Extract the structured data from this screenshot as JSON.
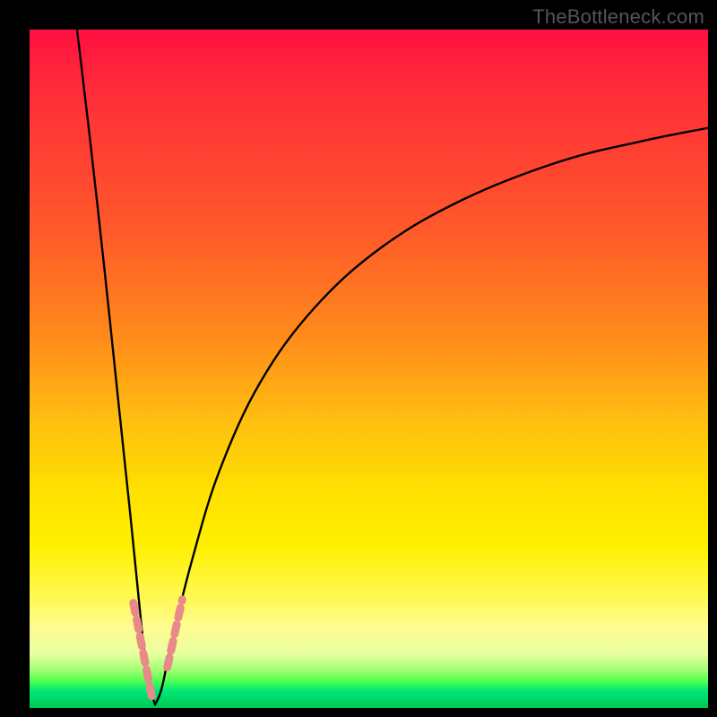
{
  "watermark": "TheBottleneck.com",
  "chart_data": {
    "type": "line",
    "title": "",
    "xlabel": "",
    "ylabel": "",
    "xlim": [
      0,
      100
    ],
    "ylim": [
      0,
      100
    ],
    "grid": false,
    "legend": false,
    "annotations": [],
    "curves": {
      "left_branch": {
        "description": "Steep descending black curve from top-left to valley ~18% width",
        "points": [
          {
            "x": 7.0,
            "y": 100.0
          },
          {
            "x": 9.0,
            "y": 83.0
          },
          {
            "x": 11.0,
            "y": 65.0
          },
          {
            "x": 13.0,
            "y": 46.0
          },
          {
            "x": 15.0,
            "y": 27.0
          },
          {
            "x": 16.5,
            "y": 12.0
          },
          {
            "x": 17.5,
            "y": 4.0
          },
          {
            "x": 18.5,
            "y": 0.5
          }
        ]
      },
      "right_branch": {
        "description": "Black curve rising from valley, asymptoting toward ~86% height at right edge",
        "points": [
          {
            "x": 18.5,
            "y": 0.5
          },
          {
            "x": 19.5,
            "y": 3.0
          },
          {
            "x": 21.0,
            "y": 10.0
          },
          {
            "x": 24.0,
            "y": 22.0
          },
          {
            "x": 28.0,
            "y": 35.0
          },
          {
            "x": 34.0,
            "y": 48.0
          },
          {
            "x": 42.0,
            "y": 59.0
          },
          {
            "x": 52.0,
            "y": 68.0
          },
          {
            "x": 64.0,
            "y": 75.0
          },
          {
            "x": 78.0,
            "y": 80.5
          },
          {
            "x": 90.0,
            "y": 83.5
          },
          {
            "x": 100.0,
            "y": 85.5
          }
        ]
      }
    },
    "highlight_segments": {
      "description": "Salmon-colored thick dashed markers near valley on both branches",
      "color": "#e88a8a",
      "left": [
        {
          "x": 15.3,
          "y": 15.5
        },
        {
          "x": 18.2,
          "y": 0.8
        }
      ],
      "right": [
        {
          "x": 20.3,
          "y": 6.0
        },
        {
          "x": 22.5,
          "y": 16.0
        }
      ]
    },
    "background_gradient": {
      "top": "#ff1040",
      "mid": "#fff000",
      "bottom": "#00c853"
    }
  }
}
